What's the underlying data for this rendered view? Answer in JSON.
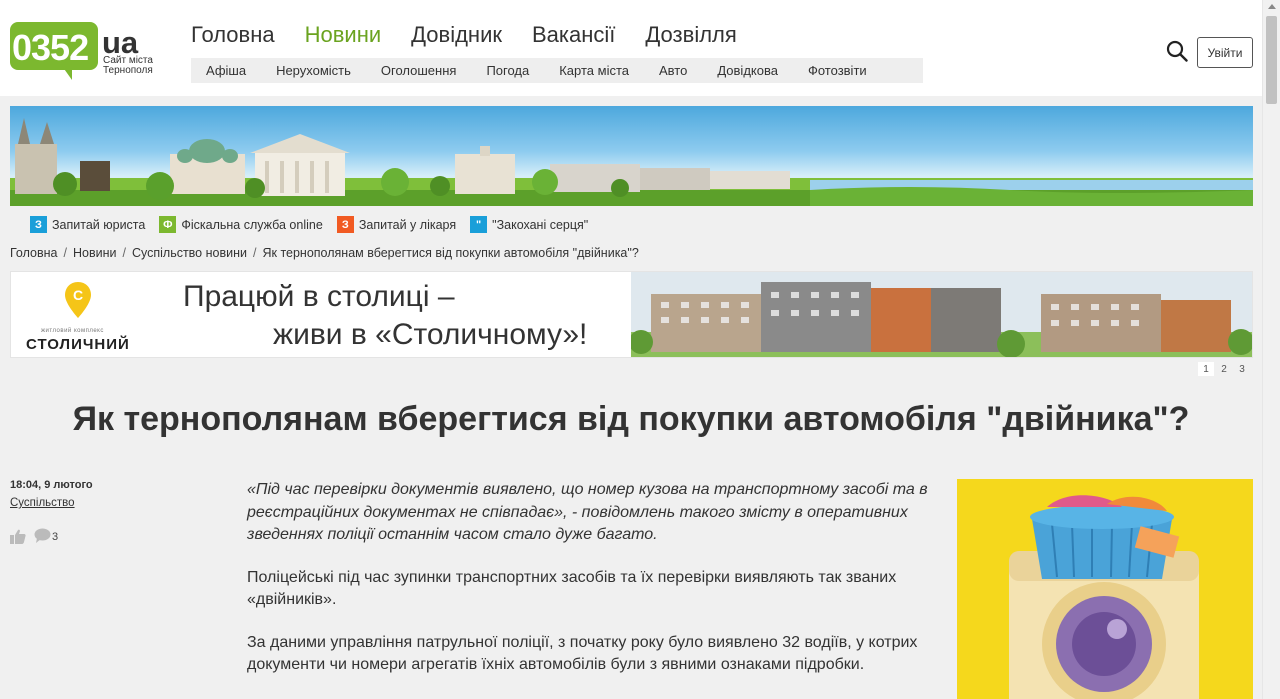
{
  "logo": {
    "number": "0352",
    "domain": "ua",
    "subtitle": "Сайт міста Тернополя"
  },
  "main_nav": [
    {
      "label": "Головна",
      "active": false
    },
    {
      "label": "Новини",
      "active": true
    },
    {
      "label": "Довідник",
      "active": false
    },
    {
      "label": "Вакансії",
      "active": false
    },
    {
      "label": "Дозвілля",
      "active": false
    }
  ],
  "sub_nav": [
    "Афіша",
    "Нерухомість",
    "Оголошення",
    "Погода",
    "Карта міста",
    "Авто",
    "Довідкова",
    "Фотозвіти"
  ],
  "header": {
    "login_label": "Увійти",
    "search_icon": "search-icon"
  },
  "quick_links": [
    {
      "badge": "З",
      "label": "Запитай юриста",
      "color": "#1a9fd9"
    },
    {
      "badge": "Ф",
      "label": "Фіскальна служба online",
      "color": "#7cb82f"
    },
    {
      "badge": "З",
      "label": "Запитай у лікаря",
      "color": "#f15a22"
    },
    {
      "badge": "\"",
      "label": "\"Закохані серця\"",
      "color": "#1a9fd9"
    }
  ],
  "breadcrumb": [
    "Головна",
    "Новини",
    "Суспільство новини",
    "Як тернополянам вберегтися від покупки автомобіля \"двійника\"?"
  ],
  "ad": {
    "logo_small": "житловий комплекс",
    "logo_name": "СТОЛИЧНИЙ",
    "logo_letter": "С",
    "line1": "Працюй в столиці –",
    "line2": "живи в «Столичному»!"
  },
  "pager": [
    "1",
    "2",
    "3"
  ],
  "article": {
    "title": "Як тернополянам вберегтися від покупки автомобіля \"двійника\"?",
    "time": "18:04, 9 лютого",
    "category": "Суспільство",
    "comments": "3",
    "paragraphs": [
      "«Під час перевірки документів виявлено, що номер кузова на транспортному засобі та в реєстраційних документах не співпадає», - повідомлень такого змісту в оперативних зведеннях поліції останнім часом стало дуже багато.",
      "Поліцейські під час зупинки транспортних засобів та їх перевірки виявляють так званих «двійників».",
      "За даними управління патрульної поліції, з початку року було виявлено 32 водіїв, у котрих документи чи номери агрегатів їхніх автомобілів були з явними ознаками підробки."
    ]
  },
  "colors": {
    "brand_green": "#7cb82f",
    "active_nav": "#6aa31f",
    "side_ad_bg": "#f5d81c"
  }
}
